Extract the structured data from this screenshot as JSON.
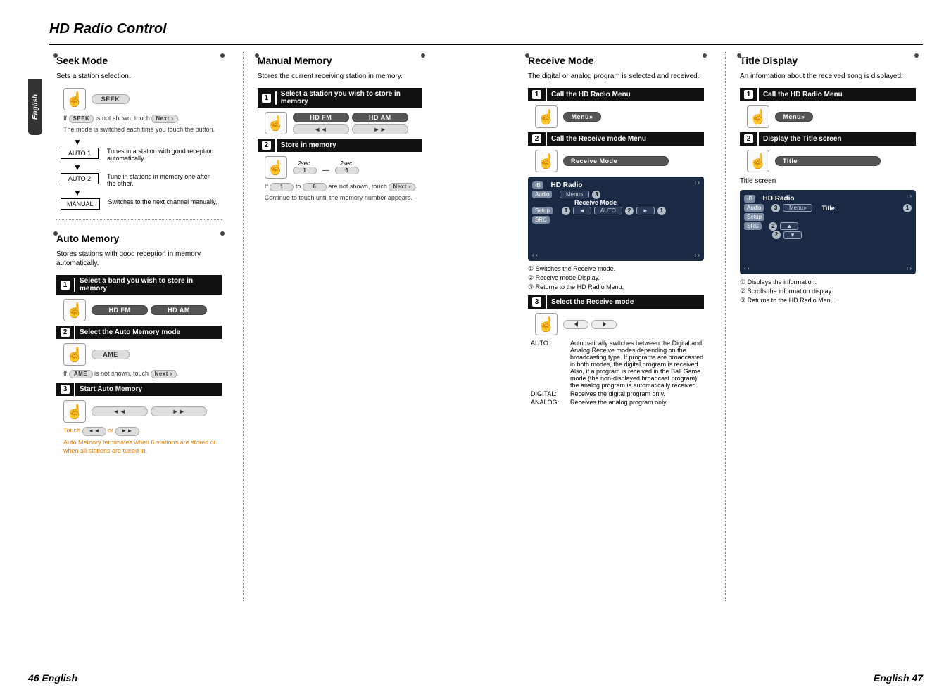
{
  "page": {
    "title": "HD Radio Control",
    "langTab": "English",
    "footerLeft": "46 English",
    "footerRight": "English 47"
  },
  "labels": {
    "seek": "SEEK",
    "hdfm": "HD FM",
    "hdam": "HD AM",
    "ame": "AME",
    "menu": "Menu»",
    "title": "Title",
    "receiveMode": "Receive Mode",
    "next": "Next ›",
    "one": "1",
    "six": "6",
    "twoSec": "2sec.",
    "prev": "◄◄",
    "fwd": "►►",
    "auto": "AUTO",
    "titleField": "Title:",
    "hdRadioHdr": "HD Radio",
    "audio": "Audio",
    "setup": "Setup",
    "src": "SRC",
    "up": "▲",
    "down": "▼",
    "arrowL": "◄",
    "arrowR": "►",
    "back": "‹B"
  },
  "seekMode": {
    "title": "Seek Mode",
    "desc": "Sets a station selection.",
    "note1a": "If ",
    "note1b": " is not shown, touch ",
    "note1c": ".",
    "note2": "The mode is switched each time you touch the button.",
    "auto1": "AUTO 1",
    "auto1Desc": "Tunes in a station with good reception automatically.",
    "auto2": "AUTO 2",
    "auto2Desc": "Tune in stations in memory one after the other.",
    "manual": "MANUAL",
    "manualDesc": "Switches to the next channel manually."
  },
  "autoMemory": {
    "title": "Auto Memory",
    "desc": "Stores stations with good reception in memory automatically.",
    "step1": "Select a band you wish to store in memory",
    "step2": "Select the Auto Memory mode",
    "note1a": "If ",
    "note1b": " is not shown, touch ",
    "note1c": ".",
    "step3": "Start Auto Memory",
    "tipA": "Touch ",
    "tipB": " or ",
    "tipC": ".",
    "tip2": "Auto Memory terminates when 6 stations are stored or when all stations are tuned in."
  },
  "manualMemory": {
    "title": "Manual Memory",
    "desc": "Stores the current receiving station in memory.",
    "step1": "Select a station you wish to store in memory",
    "step2": "Store in memory",
    "noteA": "If ",
    "noteB": " to ",
    "noteC": " are not shown, touch ",
    "noteD": ".",
    "note2": "Continue to touch until the memory number appears."
  },
  "receive": {
    "title": "Receive Mode",
    "desc": "The digital or analog program is selected and received.",
    "step1": "Call the HD Radio Menu",
    "step2": "Call the Receive mode Menu",
    "step3": "Select the Receive mode",
    "screenLabel": "Receive Mode",
    "c1": "① Switches the Receive mode.",
    "c2": "② Receive mode Display.",
    "c3": "③ Returns to the HD Radio Menu.",
    "autoK": "AUTO:",
    "autoV": "Automatically switches between the Digital and Analog Receive modes depending on the broadcasting type. If programs are broadcasted in both modes, the digital program is received. Also, if a program is received in the Ball Game mode (the non-displayed broadcast program), the analog program is automatically received.",
    "digK": "DIGITAL:",
    "digV": "Receives the digital program only.",
    "anaK": "ANALOG:",
    "anaV": "Receives the analog program only."
  },
  "titleDisplay": {
    "title": "Title Display",
    "desc": "An information about the received song is displayed.",
    "step1": "Call the HD Radio Menu",
    "step2": "Display the Title screen",
    "screenCaption": "Title screen",
    "c1": "① Displays the information.",
    "c2": "② Scrolls the information display.",
    "c3": "③ Returns to the HD Radio Menu."
  }
}
